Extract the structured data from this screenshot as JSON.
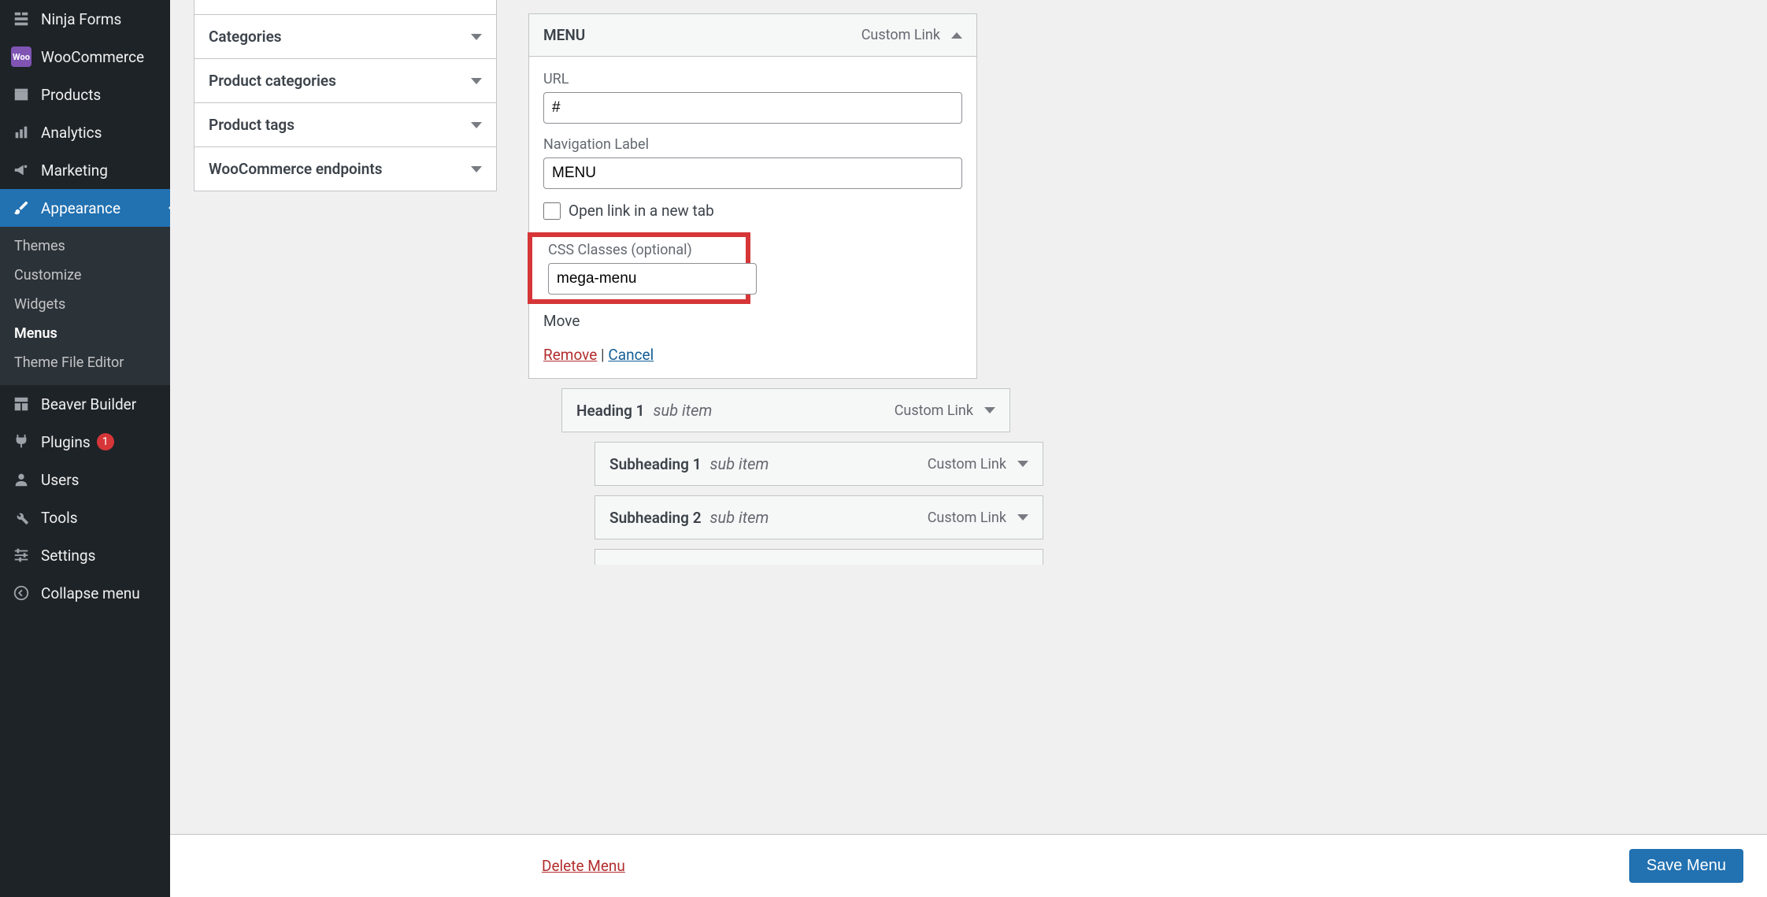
{
  "sidebar": {
    "ninja": "Ninja Forms",
    "woocommerce": "WooCommerce",
    "products": "Products",
    "analytics": "Analytics",
    "marketing": "Marketing",
    "appearance": "Appearance",
    "appearance_sub": {
      "themes": "Themes",
      "customize": "Customize",
      "widgets": "Widgets",
      "menus": "Menus",
      "theme_editor": "Theme File Editor"
    },
    "beaver": "Beaver Builder",
    "plugins": "Plugins",
    "plugins_badge": "1",
    "users": "Users",
    "tools": "Tools",
    "settings": "Settings",
    "collapse": "Collapse menu"
  },
  "accordions": {
    "categories": "Categories",
    "product_categories": "Product categories",
    "product_tags": "Product tags",
    "woo_endpoints": "WooCommerce endpoints"
  },
  "menu_item": {
    "title": "MENU",
    "type": "Custom Link",
    "url_label": "URL",
    "url_value": "#",
    "nav_label": "Navigation Label",
    "nav_value": "MENU",
    "open_tab": "Open link in a new tab",
    "css_label": "CSS Classes (optional)",
    "css_value": "mega-menu",
    "move": "Move",
    "remove": "Remove",
    "separator": " | ",
    "cancel": "Cancel"
  },
  "children": {
    "h1": {
      "title": "Heading 1",
      "sub": "sub item",
      "type": "Custom Link"
    },
    "s1": {
      "title": "Subheading 1",
      "sub": "sub item",
      "type": "Custom Link"
    },
    "s2": {
      "title": "Subheading 2",
      "sub": "sub item",
      "type": "Custom Link"
    }
  },
  "footer": {
    "delete": "Delete Menu",
    "save": "Save Menu"
  }
}
